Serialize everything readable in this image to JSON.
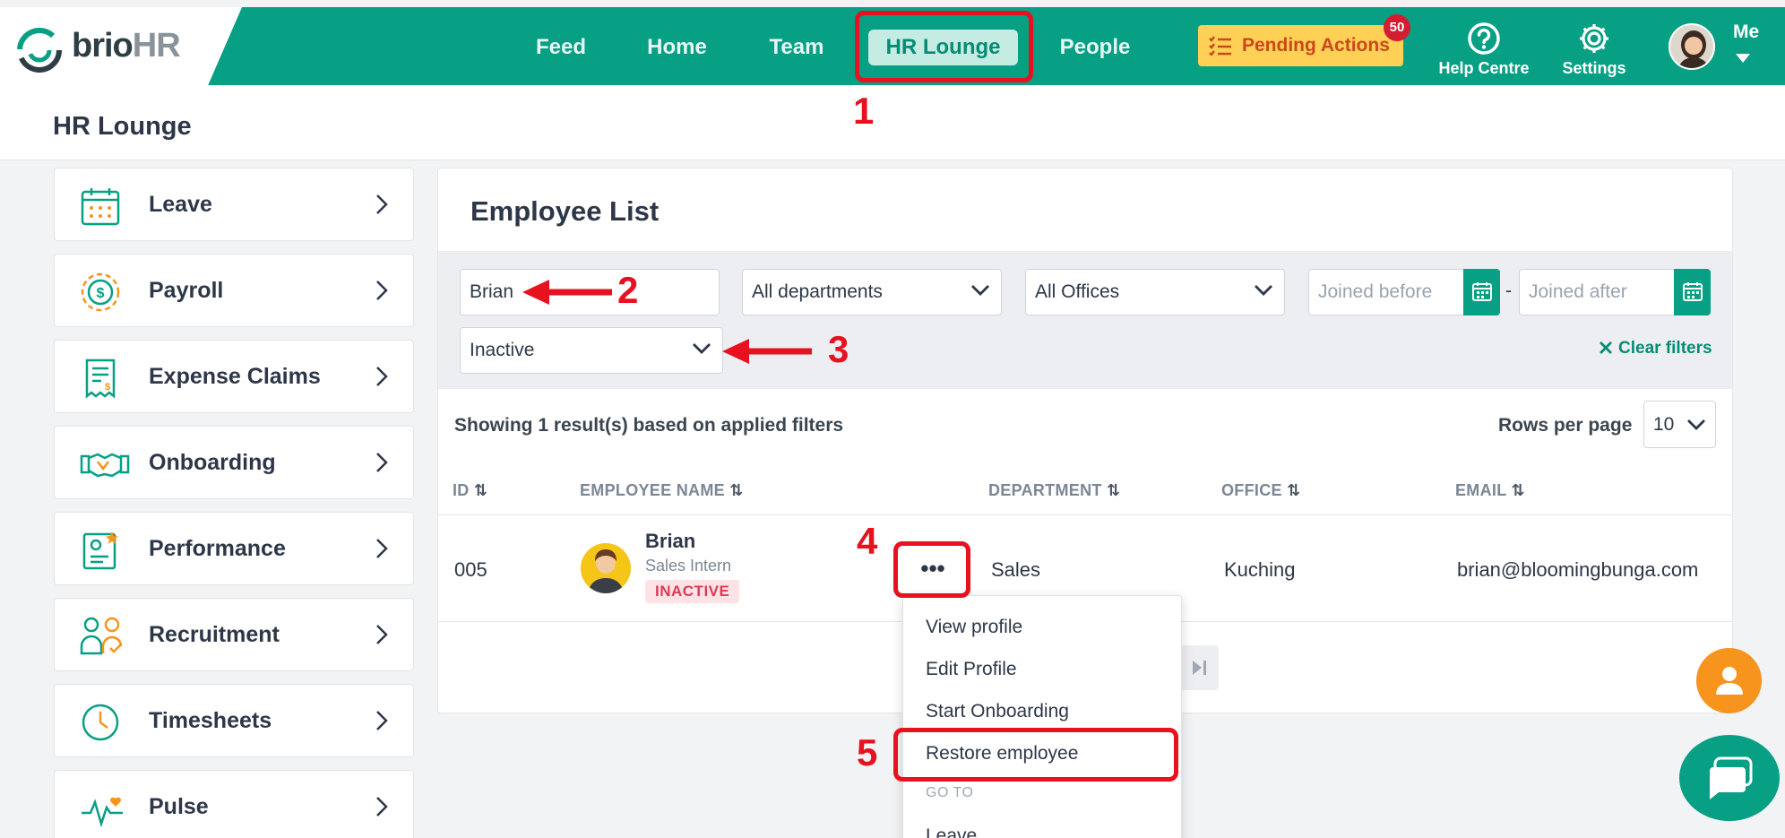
{
  "brand": {
    "name_main": "brio",
    "name_suffix": "HR"
  },
  "nav": {
    "items": [
      "Feed",
      "Home",
      "Team",
      "HR Lounge",
      "People"
    ],
    "pending_label": "Pending Actions",
    "pending_count": "50",
    "help_label": "Help Centre",
    "settings_label": "Settings",
    "me_label": "Me"
  },
  "page": {
    "title": "HR Lounge"
  },
  "sidebar": {
    "items": [
      {
        "label": "Leave",
        "icon": "calendar-icon"
      },
      {
        "label": "Payroll",
        "icon": "dollar-coin-icon"
      },
      {
        "label": "Expense Claims",
        "icon": "receipt-icon"
      },
      {
        "label": "Onboarding",
        "icon": "handshake-icon"
      },
      {
        "label": "Performance",
        "icon": "performance-icon"
      },
      {
        "label": "Recruitment",
        "icon": "recruitment-icon"
      },
      {
        "label": "Timesheets",
        "icon": "clock-icon"
      },
      {
        "label": "Pulse",
        "icon": "pulse-icon"
      }
    ]
  },
  "employee_list": {
    "title": "Employee List",
    "filters": {
      "search_value": "Brian",
      "department": "All departments",
      "office": "All Offices",
      "joined_before_placeholder": "Joined before",
      "joined_after_placeholder": "Joined after",
      "date_separator": "-",
      "status": "Inactive",
      "clear_label": "Clear filters"
    },
    "result_text": "Showing 1 result(s) based on applied filters",
    "rows_per_page_label": "Rows per page",
    "rows_per_page_value": "10",
    "columns": [
      "ID",
      "EMPLOYEE NAME",
      "DEPARTMENT",
      "OFFICE",
      "EMAIL"
    ],
    "rows": [
      {
        "id": "005",
        "name": "Brian",
        "role": "Sales Intern",
        "status": "INACTIVE",
        "department": "Sales",
        "office": "Kuching",
        "email": "brian@bloomingbunga.com"
      }
    ]
  },
  "row_menu": {
    "items": [
      "View profile",
      "Edit Profile",
      "Start Onboarding",
      "Restore employee"
    ],
    "section_label": "GO TO",
    "section_items": [
      "Leave"
    ]
  },
  "annotations": {
    "steps": [
      "1",
      "2",
      "3",
      "4",
      "5"
    ],
    "color": "#e8111f"
  },
  "colors": {
    "brand": "#07a084",
    "pending": "#fed055",
    "badge": "#d11e33",
    "fab": "#f7941d"
  }
}
